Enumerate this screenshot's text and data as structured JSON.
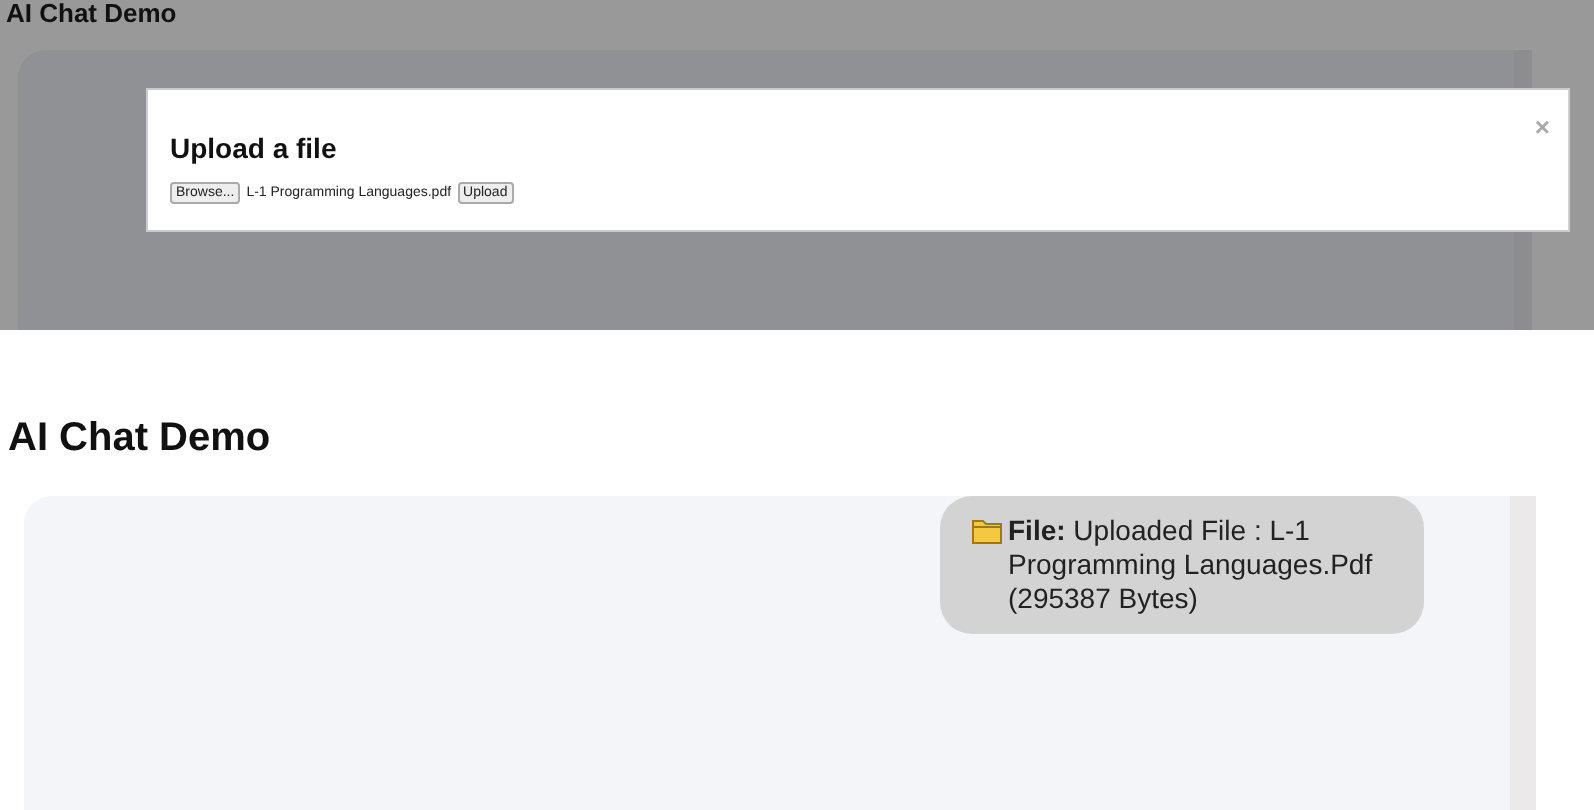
{
  "upload_view": {
    "title": "AI Chat Demo",
    "dialog": {
      "title": "Upload a file",
      "close": "×",
      "browse_button": "Browse...",
      "file_name": "L-1 Programming Languages.pdf",
      "upload_button": "Upload"
    }
  },
  "chat_view": {
    "title": "AI Chat Demo",
    "messages": [
      {
        "text": "**File:** Uploaded File : L-1 Programming Languages.Pdf (295387 Bytes)"
      }
    ]
  }
}
